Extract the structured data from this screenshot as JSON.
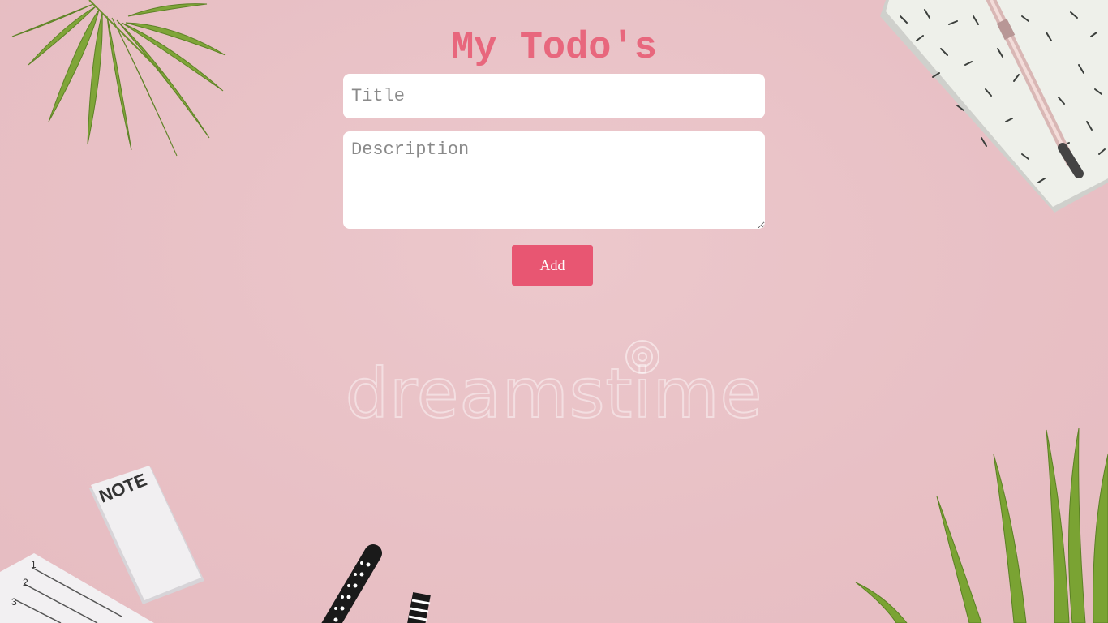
{
  "page": {
    "title": "My Todo's"
  },
  "form": {
    "title_placeholder": "Title",
    "title_value": "",
    "description_placeholder": "Description",
    "description_value": "",
    "add_label": "Add"
  },
  "background": {
    "watermark": "dreamstime",
    "notepad_label": "NOTE"
  },
  "colors": {
    "accent": "#e8677d",
    "button": "#e85672",
    "background": "#eac4c8",
    "input_bg": "#ffffff"
  }
}
